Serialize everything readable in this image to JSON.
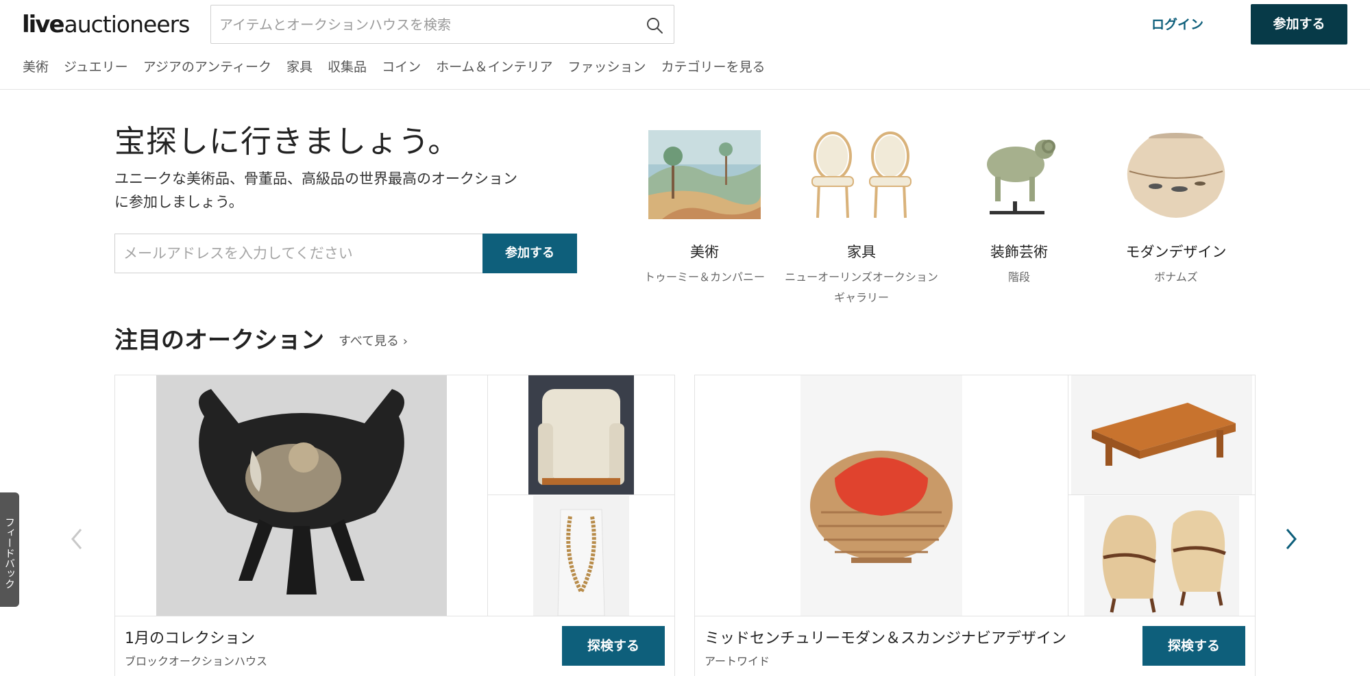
{
  "header": {
    "logo_bold": "live",
    "logo_rest": "auctioneers",
    "search_placeholder": "アイテムとオークションハウスを検索",
    "login": "ログイン",
    "join": "参加する"
  },
  "nav": [
    "美術",
    "ジュエリー",
    "アジアのアンティーク",
    "家具",
    "収集品",
    "コイン",
    "ホーム＆インテリア",
    "ファッション",
    "カテゴリーを見る"
  ],
  "hero": {
    "title": "宝探しに行きましょう。",
    "subtitle": "ユニークな美術品、骨董品、高級品の世界最高のオークションに参加しましょう。",
    "email_placeholder": "メールアドレスを入力してください",
    "join": "参加する"
  },
  "categories": [
    {
      "name": "美術",
      "house": "トゥーミー＆カンパニー"
    },
    {
      "name": "家具",
      "house": "ニューオーリンズオークションギャラリー"
    },
    {
      "name": "装飾芸術",
      "house": "階段"
    },
    {
      "name": "モダンデザイン",
      "house": "ボナムズ"
    }
  ],
  "featured": {
    "title": "注目のオークション",
    "see_all": "すべて見る ›",
    "cards": [
      {
        "title": "1月のコレクション",
        "house": "ブロックオークションハウス",
        "button": "探検する"
      },
      {
        "title": "ミッドセンチュリーモダン＆スカンジナビアデザイン",
        "house": "アートワイド",
        "button": "探検する"
      }
    ]
  },
  "feedback": "フィードバック",
  "colors": {
    "brand_dark": "#073a48",
    "brand": "#0e5f7b",
    "nav_text": "#555555"
  }
}
